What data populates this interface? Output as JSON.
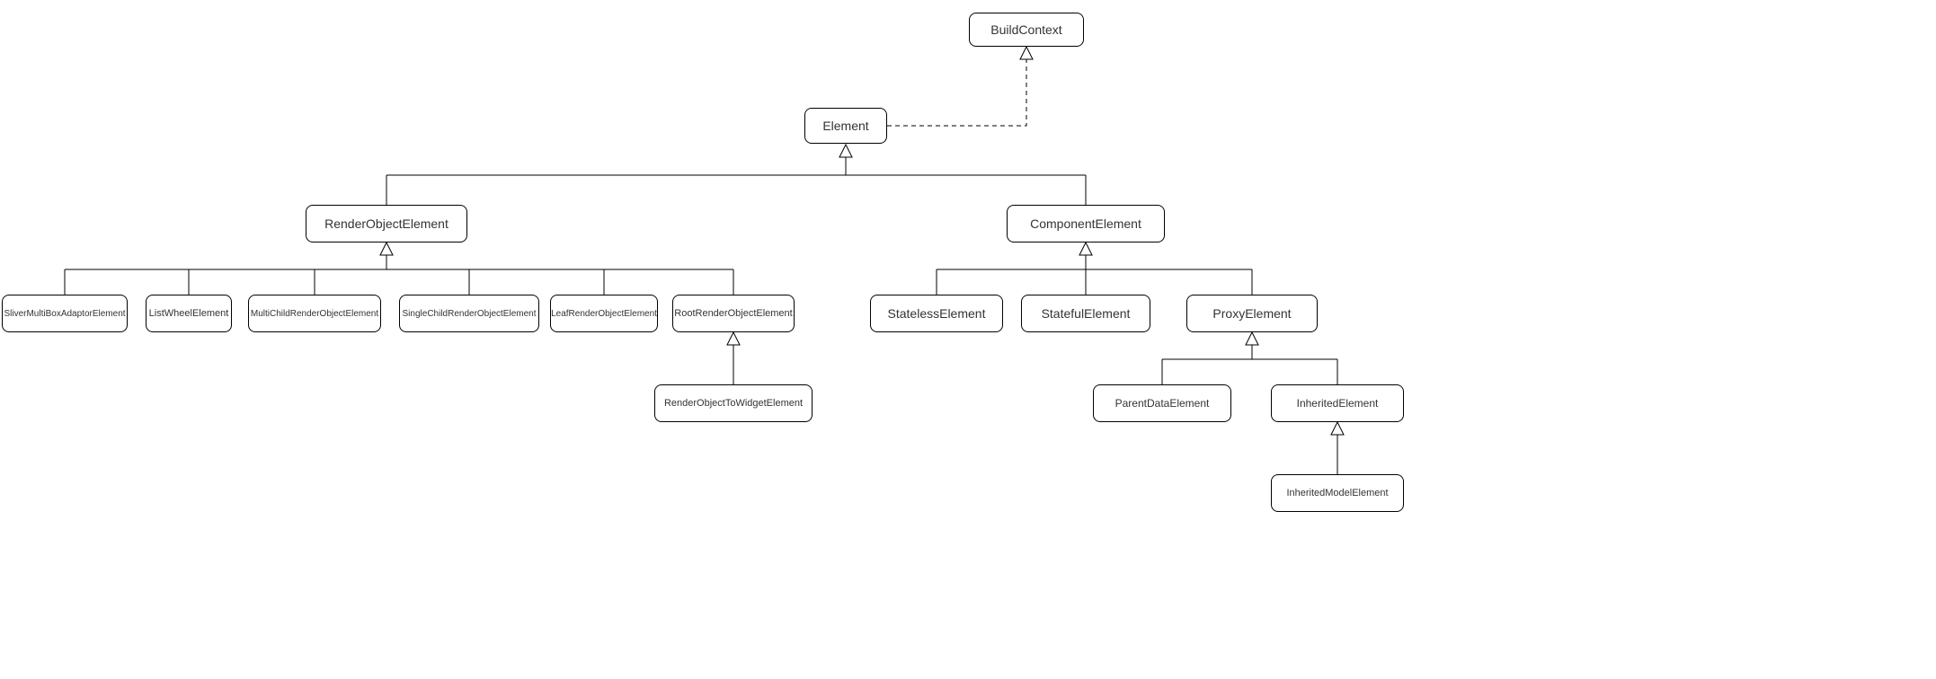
{
  "diagram": {
    "type": "uml-class-hierarchy",
    "description": "Flutter Element class hierarchy UML diagram",
    "nodes": {
      "BuildContext": "BuildContext",
      "Element": "Element",
      "RenderObjectElement": "RenderObjectElement",
      "ComponentElement": "ComponentElement",
      "SliverMultiBoxAdaptorElement": "SliverMultiBoxAdaptorElement",
      "ListWheelElement": "ListWheelElement",
      "MultiChildRenderObjectElement": "MultiChildRenderObjectElement",
      "SingleChildRenderObjectElement": "SingleChildRenderObjectElement",
      "LeafRenderObjectElement": "LeafRenderObjectElement",
      "RootRenderObjectElement": "RootRenderObjectElement",
      "RenderObjectToWidgetElement": "RenderObjectToWidgetElement",
      "StatelessElement": "StatelessElement",
      "StatefulElement": "StatefulElement",
      "ProxyElement": "ProxyElement",
      "ParentDataElement": "ParentDataElement",
      "InheritedElement": "InheritedElement",
      "InheritedModelElement": "InheritedModelElement"
    },
    "edges": [
      {
        "from": "Element",
        "to": "BuildContext",
        "type": "realization"
      },
      {
        "from": "RenderObjectElement",
        "to": "Element",
        "type": "generalization"
      },
      {
        "from": "ComponentElement",
        "to": "Element",
        "type": "generalization"
      },
      {
        "from": "SliverMultiBoxAdaptorElement",
        "to": "RenderObjectElement",
        "type": "generalization"
      },
      {
        "from": "ListWheelElement",
        "to": "RenderObjectElement",
        "type": "generalization"
      },
      {
        "from": "MultiChildRenderObjectElement",
        "to": "RenderObjectElement",
        "type": "generalization"
      },
      {
        "from": "SingleChildRenderObjectElement",
        "to": "RenderObjectElement",
        "type": "generalization"
      },
      {
        "from": "LeafRenderObjectElement",
        "to": "RenderObjectElement",
        "type": "generalization"
      },
      {
        "from": "RootRenderObjectElement",
        "to": "RenderObjectElement",
        "type": "generalization"
      },
      {
        "from": "RenderObjectToWidgetElement",
        "to": "RootRenderObjectElement",
        "type": "generalization"
      },
      {
        "from": "StatelessElement",
        "to": "ComponentElement",
        "type": "generalization"
      },
      {
        "from": "StatefulElement",
        "to": "ComponentElement",
        "type": "generalization"
      },
      {
        "from": "ProxyElement",
        "to": "ComponentElement",
        "type": "generalization"
      },
      {
        "from": "ParentDataElement",
        "to": "ProxyElement",
        "type": "generalization"
      },
      {
        "from": "InheritedElement",
        "to": "ProxyElement",
        "type": "generalization"
      },
      {
        "from": "InheritedModelElement",
        "to": "InheritedElement",
        "type": "generalization"
      }
    ]
  }
}
